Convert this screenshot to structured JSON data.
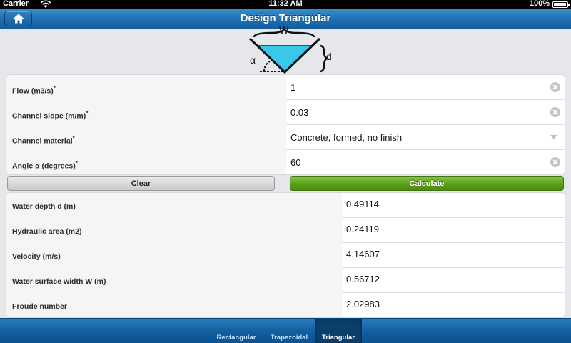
{
  "status_bar": {
    "carrier": "Carrier",
    "time": "11:32 AM",
    "battery": "100%"
  },
  "header": {
    "title": "Design Triangular",
    "home_icon": "home-icon"
  },
  "diagram": {
    "width_label": "W",
    "depth_label": "d",
    "angle_label": "α"
  },
  "inputs": [
    {
      "label": "Flow (m3/s)",
      "required": "*",
      "value": "1",
      "control": "clear-icon"
    },
    {
      "label": "Channel slope (m/m)",
      "required": "*",
      "value": "0.03",
      "control": "clear-icon"
    },
    {
      "label": "Channel material",
      "required": "*",
      "value": "Concrete, formed, no finish",
      "control": "dropdown-icon"
    },
    {
      "label": "Angle α (degrees)",
      "required": "*",
      "value": "60",
      "control": "clear-icon"
    }
  ],
  "buttons": {
    "clear": "Clear",
    "calculate": "Calculate"
  },
  "results": [
    {
      "label": "Water depth d (m)",
      "value": "0.49114"
    },
    {
      "label": "Hydraulic area (m2)",
      "value": "0.24119"
    },
    {
      "label": "Velocity (m/s)",
      "value": "4.14607"
    },
    {
      "label": "Water surface width W (m)",
      "value": "0.56712"
    },
    {
      "label": "Froude number",
      "value": "2.02983"
    }
  ],
  "tabs": [
    {
      "label": "Rectangular",
      "active": false
    },
    {
      "label": "Trapezoidal",
      "active": false
    },
    {
      "label": "Triangular",
      "active": true
    }
  ],
  "colors": {
    "nav_blue": "#1f6fb0",
    "calculate_green": "#5a9e1c",
    "water": "#38c8ea"
  }
}
